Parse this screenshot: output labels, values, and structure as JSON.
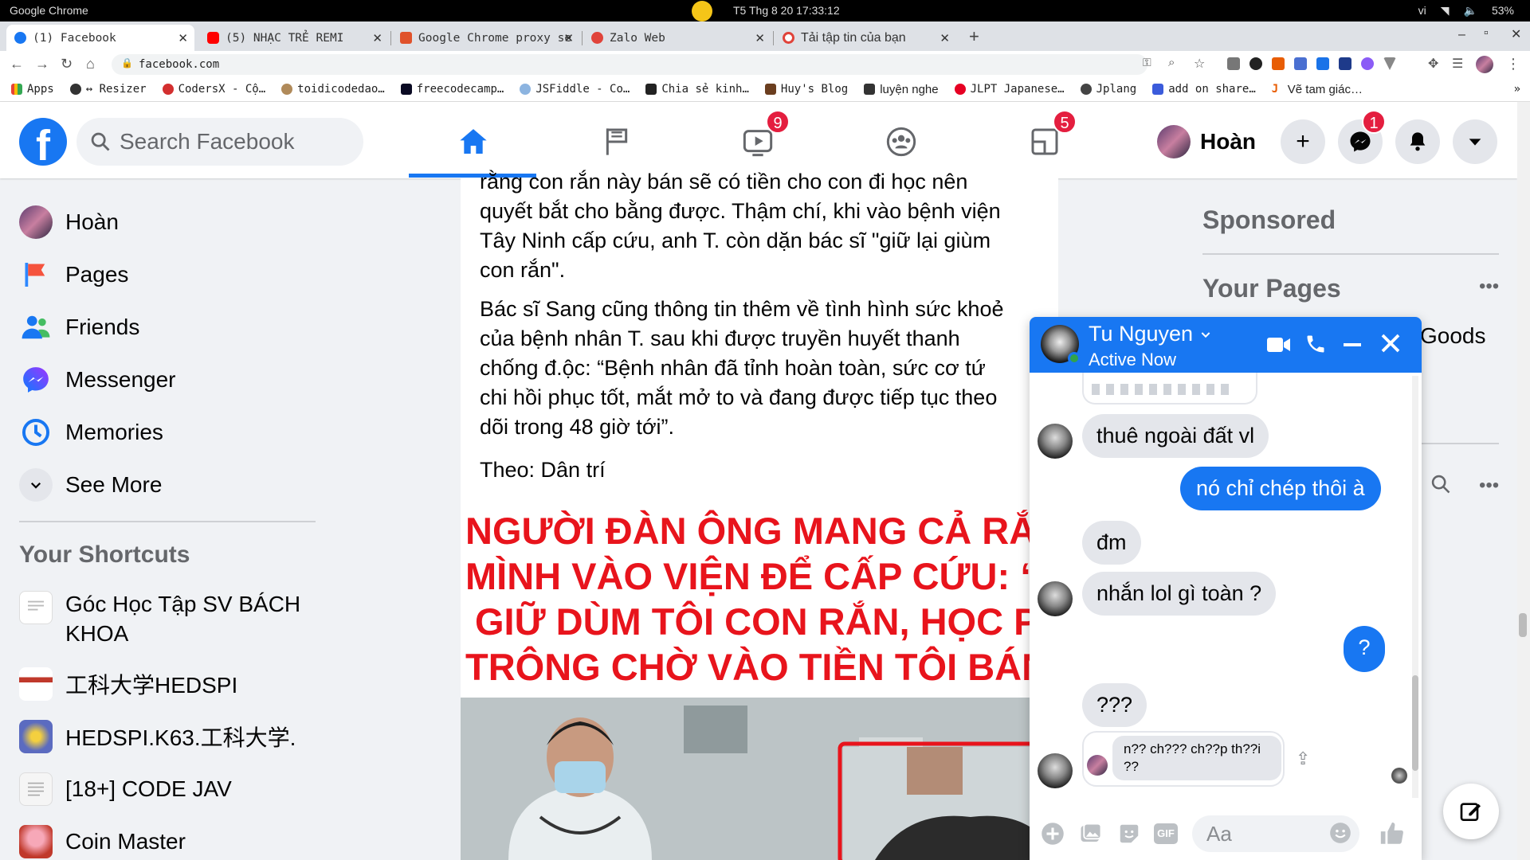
{
  "os": {
    "app_name": "Google Chrome",
    "datetime": "T5 Thg 8 20  17:33:12",
    "lang": "vi",
    "battery": "53%"
  },
  "tabs": [
    {
      "title": "(1) Facebook",
      "color": "#1877f2"
    },
    {
      "title": "(5) NHẠC TRẺ REMI",
      "color": "#ff0000"
    },
    {
      "title": "Google Chrome proxy se",
      "color": "#e0522b"
    },
    {
      "title": "Zalo Web",
      "color": "#e0433a"
    },
    {
      "title": "Tải tập tin của bạn",
      "color": "#e0433a"
    }
  ],
  "address": {
    "url": "facebook.com"
  },
  "bookmarks": [
    "Apps",
    "↔ Resizer",
    "CodersX - Cộ…",
    "toidicodedao…",
    "freecodecamp…",
    "JSFiddle - Co…",
    "Chia sẻ kinh…",
    "Huy's Blog",
    "luyện nghe",
    "JLPT Japanese…",
    "Jplang",
    "add on share…",
    "Vẽ tam giác…"
  ],
  "fb": {
    "search_placeholder": "Search Facebook",
    "badges": {
      "watch": "9",
      "gaming": "5",
      "messenger": "1"
    },
    "user_name": "Hoàn",
    "brand_color": "#1877f2"
  },
  "sidebar": {
    "items": [
      {
        "label": "Hoàn"
      },
      {
        "label": "Pages"
      },
      {
        "label": "Friends"
      },
      {
        "label": "Messenger"
      },
      {
        "label": "Memories"
      },
      {
        "label": "See More"
      }
    ],
    "shortcuts_title": "Your Shortcuts",
    "shortcuts": [
      {
        "label": "Góc Học Tập SV BÁCH KHOA"
      },
      {
        "label": "工科大学HEDSPI"
      },
      {
        "label": "HEDSPI.K63.工科大学."
      },
      {
        "label": "[18+] CODE JAV"
      },
      {
        "label": "Coin Master"
      }
    ]
  },
  "post": {
    "para1_lines": [
      "rằng con rắn này bán sẽ có tiền cho con đi học nên",
      "quyết bắt cho bằng được. Thậm chí, khi vào bệnh viện",
      "Tây Ninh cấp cứu, anh T. còn dặn bác sĩ \"giữ lại giùm",
      "con rắn\"."
    ],
    "para2_lines": [
      "Bác sĩ Sang cũng thông tin thêm về tình hình sức khoẻ",
      "của bệnh nhân T. sau khi được truyền huyết thanh",
      "chống đ.ộc: “Bệnh nhân đã tỉnh hoàn toàn, sức cơ tứ",
      "chi hồi phục tốt, mắt mở to và đang được tiếp tục theo",
      "dõi trong 48 giờ tới”."
    ],
    "source": "Theo: Dân trí",
    "banner_lines": [
      "NGƯỜI ĐÀN ÔNG MANG CẢ RẮN HỔ MANG C.Ắ",
      "MÌNH VÀO VIỆN ĐỂ CẤP CỨU: “BÁC SỸ LÀM Ơ",
      "GIỮ DÙM TÔI CON RẮN, HỌC PHÍ CỦA CON TÔ",
      "TRÔNG CHỜ VÀO TIỀN TÔI BÁN CON RẮN NÀY"
    ]
  },
  "rightcol": {
    "sponsored": "Sponsored",
    "your_pages": "Your Pages",
    "page_partial": "Goods"
  },
  "chat": {
    "name": "Tu Nguyen",
    "status": "Active Now",
    "messages": [
      {
        "from": "them",
        "text": "thuê ngoài đất vl"
      },
      {
        "from": "me",
        "text": "nó chỉ chép thôi à"
      },
      {
        "from": "them",
        "text": "đm"
      },
      {
        "from": "them",
        "text": "nhắn lol gì toàn ?"
      },
      {
        "from": "me",
        "text": "?"
      },
      {
        "from": "them",
        "text": "???"
      },
      {
        "from": "them",
        "text": "n?? ch??? ch??p th??i ??"
      }
    ],
    "input_placeholder": "Aa"
  }
}
